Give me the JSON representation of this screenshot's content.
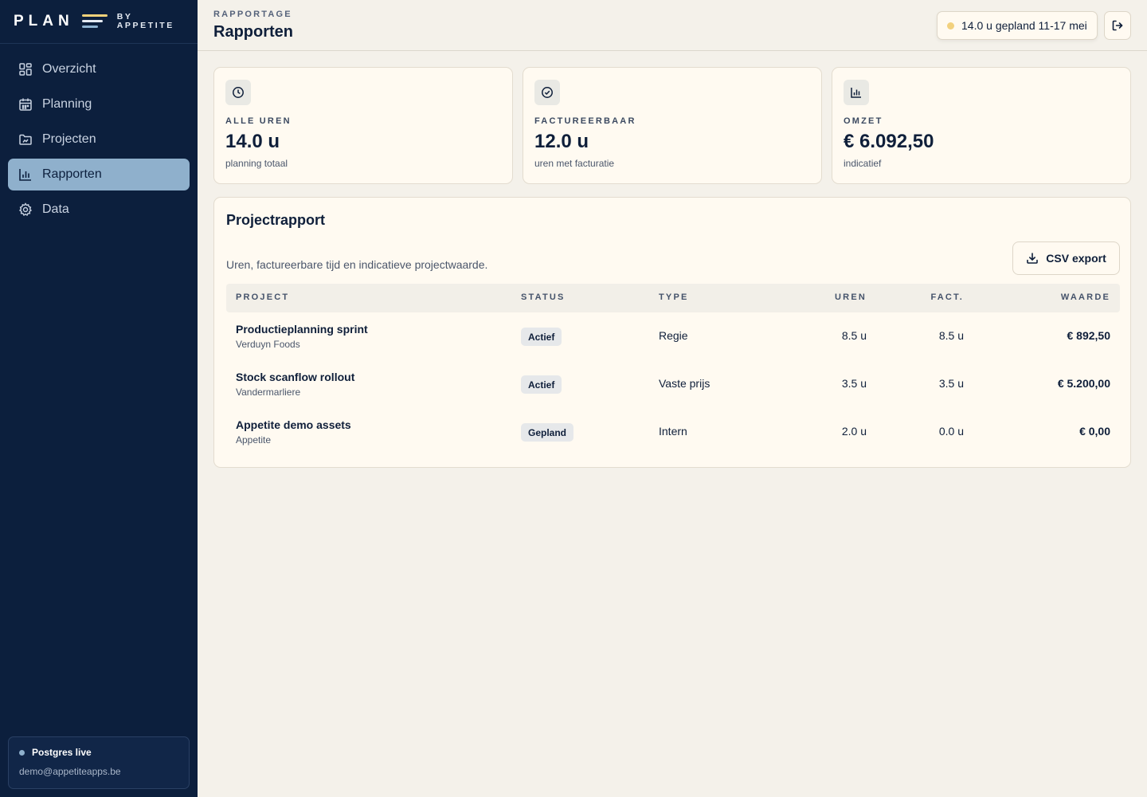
{
  "brand": {
    "plan": "PLAN",
    "by_line1": "BY",
    "by_line2": "APPETITE"
  },
  "sidebar": {
    "items": [
      {
        "label": "Overzicht",
        "icon": "grid-icon",
        "active": false
      },
      {
        "label": "Planning",
        "icon": "calendar-icon",
        "active": false
      },
      {
        "label": "Projecten",
        "icon": "folder-icon",
        "active": false
      },
      {
        "label": "Rapporten",
        "icon": "bar-chart-icon",
        "active": true
      },
      {
        "label": "Data",
        "icon": "gear-icon",
        "active": false
      }
    ],
    "db_status": "Postgres live",
    "user_email": "demo@appetiteapps.be"
  },
  "header": {
    "breadcrumb": "RAPPORTAGE",
    "title": "Rapporten",
    "week_summary": "14.0 u gepland 11-17 mei"
  },
  "stats": [
    {
      "icon": "clock-icon",
      "label": "ALLE UREN",
      "value": "14.0 u",
      "sub": "planning totaal"
    },
    {
      "icon": "check-circle-icon",
      "label": "FACTUREERBAAR",
      "value": "12.0 u",
      "sub": "uren met facturatie"
    },
    {
      "icon": "bar-chart-icon",
      "label": "OMZET",
      "value": "€ 6.092,50",
      "sub": "indicatief"
    }
  ],
  "report": {
    "title": "Projectrapport",
    "subtitle": "Uren, factureerbare tijd en indicatieve projectwaarde.",
    "csv_label": "CSV export",
    "columns": {
      "project": "PROJECT",
      "status": "STATUS",
      "type": "TYPE",
      "uren": "UREN",
      "fact": "FACT.",
      "waarde": "WAARDE"
    },
    "rows": [
      {
        "name": "Productieplanning sprint",
        "client": "Verduyn Foods",
        "status": "Actief",
        "type": "Regie",
        "uren": "8.5 u",
        "fact": "8.5 u",
        "waarde": "€ 892,50"
      },
      {
        "name": "Stock scanflow rollout",
        "client": "Vandermarliere",
        "status": "Actief",
        "type": "Vaste prijs",
        "uren": "3.5 u",
        "fact": "3.5 u",
        "waarde": "€ 5.200,00"
      },
      {
        "name": "Appetite demo assets",
        "client": "Appetite",
        "status": "Gepland",
        "type": "Intern",
        "uren": "2.0 u",
        "fact": "0.0 u",
        "waarde": "€ 0,00"
      }
    ]
  },
  "colors": {
    "sidebar_bg": "#0c1f3d",
    "active_nav": "#8fb0cc",
    "accent_yellow": "#f2d17e",
    "page_bg": "#f4f1ea",
    "card_bg": "#fffaf1"
  }
}
